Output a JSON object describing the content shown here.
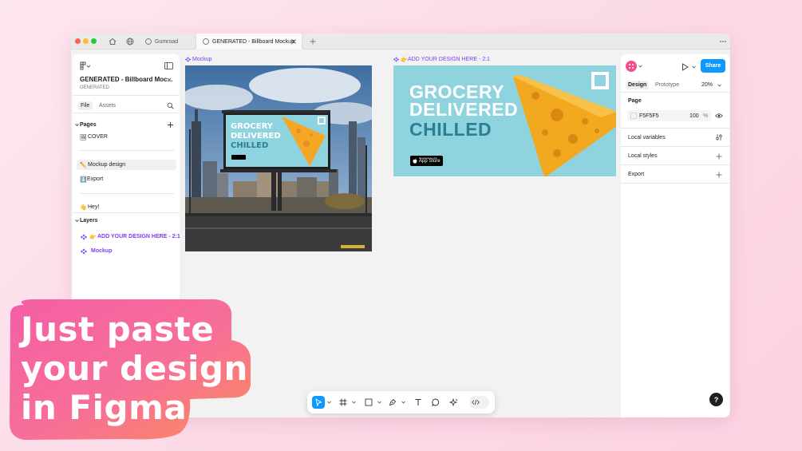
{
  "titlebar": {
    "tabs": [
      {
        "label": "Gumroad"
      },
      {
        "label": "GENERATED - Billboard Mockup"
      }
    ]
  },
  "file": {
    "name": "GENERATED - Billboard Moc...",
    "project": "GENERATED"
  },
  "left_panel": {
    "tabs": {
      "file": "File",
      "assets": "Assets"
    },
    "pages_heading": "Pages",
    "pages": [
      {
        "label": "COVER",
        "emoji": "🖼"
      },
      {
        "label": "Mockup design",
        "emoji": "✏️"
      },
      {
        "label": "Export",
        "emoji": "⬇️"
      },
      {
        "label": "Hey!",
        "emoji": "👋"
      }
    ],
    "layers_heading": "Layers",
    "layers": [
      {
        "label": "ADD YOUR DESIGN HERE - 2:1",
        "emoji": "👉"
      },
      {
        "label": "Mockup"
      }
    ]
  },
  "canvas": {
    "frame_mockup_label": "Mockup",
    "frame_design_label": "ADD YOUR DESIGN HERE - 2:1",
    "frame_design_emoji": "👉",
    "ad_lines": [
      "GROCERY",
      "DELIVERED",
      "CHILLED"
    ],
    "app_store_small": "Download on the",
    "app_store_label": "App Store"
  },
  "right_panel": {
    "tabs": {
      "design": "Design",
      "prototype": "Prototype"
    },
    "zoom": "20%",
    "share_label": "Share",
    "page_heading": "Page",
    "page_color": "F5F5F5",
    "page_opacity": "100",
    "percent": "%",
    "local_variables": "Local variables",
    "local_styles": "Local styles",
    "export": "Export"
  },
  "help_label": "?",
  "overlay": {
    "lines": [
      "Just paste",
      "your design",
      "in Figma"
    ]
  },
  "colors": {
    "accent_blue": "#0d99ff",
    "purple": "#7b3ff2",
    "ad_bg": "#8fd3df",
    "ad_white": "#ffffff",
    "ad_teal": "#2a7f95",
    "cheese": "#f5a623",
    "overlay_pink": "#f45fa6",
    "overlay_orange": "#fb8c5a"
  }
}
